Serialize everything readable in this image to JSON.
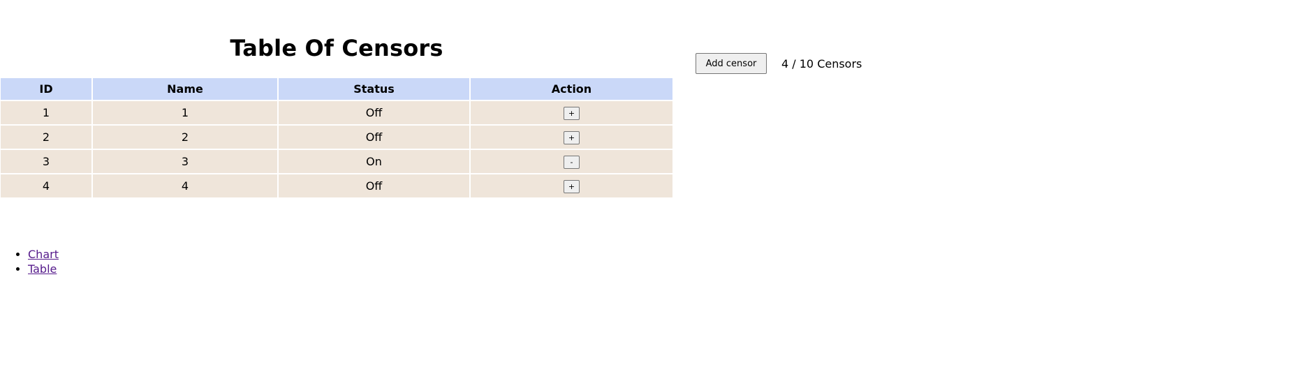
{
  "title": "Table Of Censors",
  "table": {
    "columns": [
      "ID",
      "Name",
      "Status",
      "Action"
    ],
    "rows": [
      {
        "id": "1",
        "name": "1",
        "status": "Off",
        "action": "+"
      },
      {
        "id": "2",
        "name": "2",
        "status": "Off",
        "action": "+"
      },
      {
        "id": "3",
        "name": "3",
        "status": "On",
        "action": "-"
      },
      {
        "id": "4",
        "name": "4",
        "status": "Off",
        "action": "+"
      }
    ]
  },
  "toolbar": {
    "add_label": "Add censor",
    "count_text": "4 / 10 Censors"
  },
  "nav": {
    "links": [
      "Chart",
      "Table"
    ]
  },
  "colors": {
    "header_bg": "#cad8f8",
    "row_bg": "#efe5da",
    "link": "#551a8b"
  }
}
